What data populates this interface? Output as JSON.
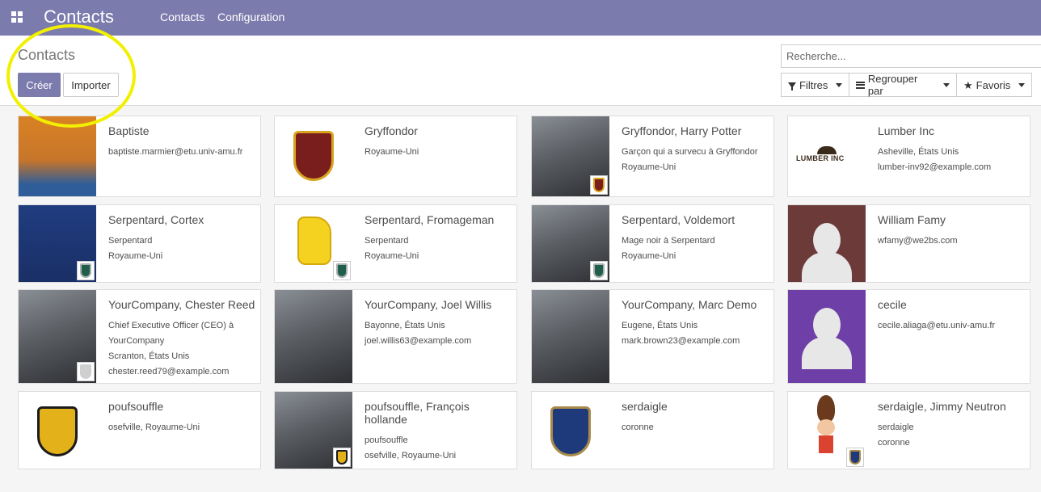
{
  "navbar": {
    "app_title": "Contacts",
    "menu": [
      "Contacts",
      "Configuration"
    ],
    "apps_icon": "grid-icon"
  },
  "control_panel": {
    "breadcrumb": "Contacts",
    "create_button": "Créer",
    "import_button": "Importer",
    "search_placeholder": "Recherche...",
    "filters_label": "Filtres",
    "group_by_label": "Regrouper par",
    "favorites_label": "Favoris"
  },
  "colors": {
    "brand": "#7c7bad",
    "highlight": "#f2f000"
  },
  "contacts": [
    {
      "name": "Baptiste",
      "lines": [
        "baptiste.marmier@etu.univ-amu.fr"
      ],
      "image": "owl-cartoon",
      "badge": null
    },
    {
      "name": "Gryffondor",
      "lines": [
        "Royaume-Uni"
      ],
      "image": "gryffindor-crest",
      "badge": null
    },
    {
      "name": "Gryffondor, Harry Potter",
      "lines": [
        "Garçon qui a survecu à Gryffondor",
        "Royaume-Uni"
      ],
      "image": "portrait-photo",
      "badge": "gryffindor-crest"
    },
    {
      "name": "Lumber Inc",
      "lines": [
        "Asheville, États Unis",
        "lumber-inv92@example.com"
      ],
      "image": "lumber-inc-logo",
      "logo_text": "LUMBER INC",
      "badge": null
    },
    {
      "name": "Serpentard, Cortex",
      "lines": [
        "Serpentard",
        "Royaume-Uni"
      ],
      "image": "cartoon-mouse",
      "badge": "slytherin-crest"
    },
    {
      "name": "Serpentard, Fromageman",
      "lines": [
        "Serpentard",
        "Royaume-Uni"
      ],
      "image": "cheese-mascot",
      "badge": "slytherin-crest"
    },
    {
      "name": "Serpentard, Voldemort",
      "lines": [
        "Mage noir à Serpentard",
        "Royaume-Uni"
      ],
      "image": "portrait-photo",
      "badge": "slytherin-crest"
    },
    {
      "name": "William Famy",
      "lines": [
        "wfamy@we2bs.com"
      ],
      "image": "default-avatar",
      "bg": "#6d3a3a",
      "badge": null
    },
    {
      "name": "YourCompany, Chester Reed",
      "lines": [
        "Chief Executive Officer (CEO) à",
        "YourCompany",
        "Scranton, États Unis",
        "chester.reed79@example.com"
      ],
      "image": "portrait-photo",
      "badge": "company-logo"
    },
    {
      "name": "YourCompany, Joel Willis",
      "lines": [
        "Bayonne, États Unis",
        "joel.willis63@example.com"
      ],
      "image": "portrait-photo",
      "badge": null
    },
    {
      "name": "YourCompany, Marc Demo",
      "lines": [
        "Eugene, États Unis",
        "mark.brown23@example.com"
      ],
      "image": "portrait-photo",
      "badge": null
    },
    {
      "name": "cecile",
      "lines": [
        "cecile.aliaga@etu.univ-amu.fr"
      ],
      "image": "default-avatar",
      "bg": "#6f3fa8",
      "badge": null
    },
    {
      "name": "poufsouffle",
      "lines": [
        "osefville, Royaume-Uni"
      ],
      "image": "hufflepuff-crest",
      "badge": null
    },
    {
      "name": "poufsouffle, François hollande",
      "lines": [
        "poufsouffle",
        "osefville, Royaume-Uni"
      ],
      "image": "portrait-photo",
      "badge": "hufflepuff-crest"
    },
    {
      "name": "serdaigle",
      "lines": [
        "coronne"
      ],
      "image": "ravenclaw-crest",
      "badge": null
    },
    {
      "name": "serdaigle, Jimmy Neutron",
      "lines": [
        "serdaigle",
        "coronne"
      ],
      "image": "cartoon-boy",
      "badge": "ravenclaw-crest"
    }
  ]
}
